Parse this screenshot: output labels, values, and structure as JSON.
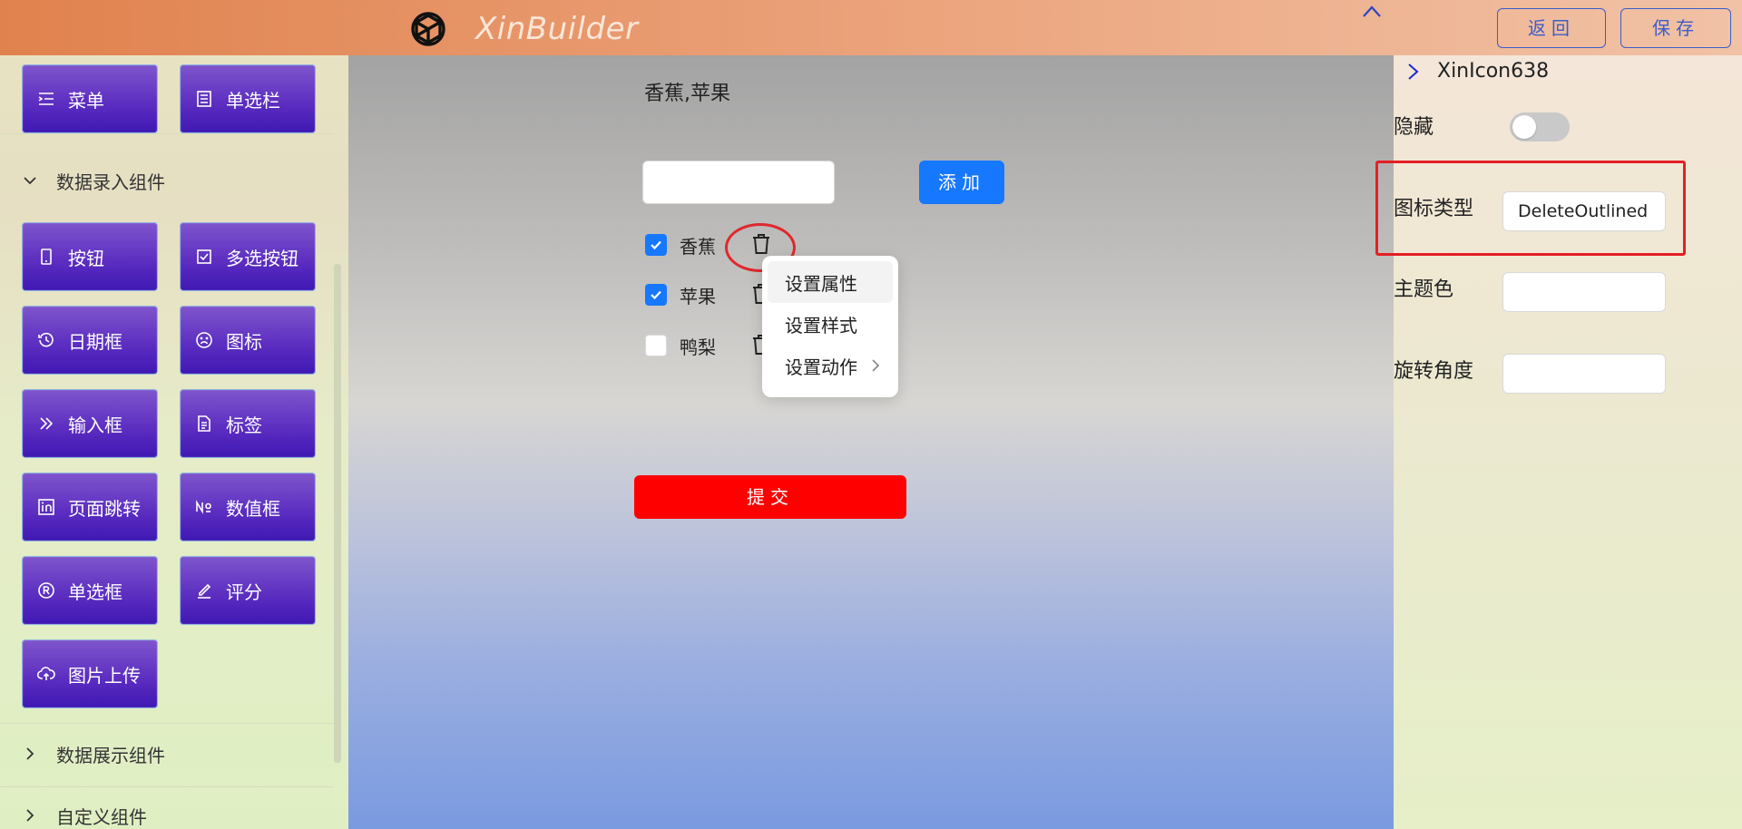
{
  "header": {
    "app_title": "XinBuilder",
    "back_label": "返回",
    "save_label": "保存"
  },
  "sidebar": {
    "top_items": [
      {
        "label": "菜单",
        "icon": "menu-icon"
      },
      {
        "label": "单选栏",
        "icon": "radio-bar-icon"
      }
    ],
    "sections": [
      {
        "title": "数据录入组件",
        "expanded": true
      },
      {
        "title": "数据展示组件",
        "expanded": false
      },
      {
        "title": "自定义组件",
        "expanded": false
      }
    ],
    "input_components": [
      {
        "label": "按钮",
        "icon": "mobile-icon"
      },
      {
        "label": "多选按钮",
        "icon": "checkbox-icon"
      },
      {
        "label": "日期框",
        "icon": "history-icon"
      },
      {
        "label": "图标",
        "icon": "frown-icon"
      },
      {
        "label": "输入框",
        "icon": "double-right-icon"
      },
      {
        "label": "标签",
        "icon": "file-text-icon"
      },
      {
        "label": "页面跳转",
        "icon": "linkedin-icon"
      },
      {
        "label": "数值框",
        "icon": "number-icon"
      },
      {
        "label": "单选框",
        "icon": "registered-icon"
      },
      {
        "label": "评分",
        "icon": "edit-icon"
      },
      {
        "label": "图片上传",
        "icon": "cloud-upload-icon"
      }
    ]
  },
  "canvas": {
    "selected_text": "香蕉,苹果",
    "add_input_value": "",
    "add_label": "添加",
    "todos": [
      {
        "label": "香蕉",
        "checked": true
      },
      {
        "label": "苹果",
        "checked": true
      },
      {
        "label": "鸭梨",
        "checked": false
      }
    ],
    "context_menu": [
      {
        "label": "设置属性",
        "active": true,
        "has_submenu": false
      },
      {
        "label": "设置样式",
        "active": false,
        "has_submenu": false
      },
      {
        "label": "设置动作",
        "active": false,
        "has_submenu": true
      }
    ],
    "submit_label": "提交"
  },
  "panel": {
    "component_name": "XinIcon638",
    "hidden_label": "隐藏",
    "hidden_value": false,
    "icon_type_label": "图标类型",
    "icon_type_value": "DeleteOutlined",
    "theme_color_label": "主题色",
    "theme_color_value": "",
    "rotate_label": "旋转角度",
    "rotate_value": ""
  },
  "colors": {
    "primary": "#1677ff",
    "submit": "#ff0000",
    "button_gradient_top": "#7e55cc",
    "button_gradient_bottom": "#3f18b3",
    "highlight": "#e41f25"
  }
}
